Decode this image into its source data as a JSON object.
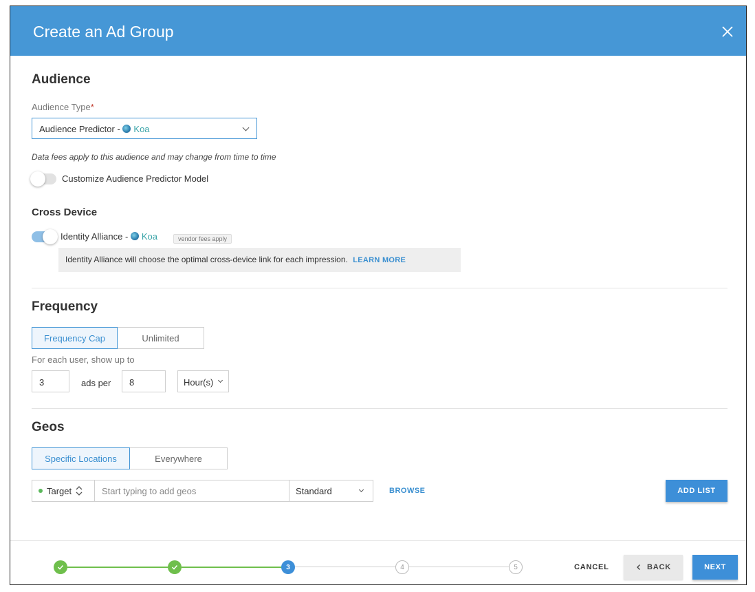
{
  "header": {
    "title": "Create an Ad Group"
  },
  "audience": {
    "section_title": "Audience",
    "type_label": "Audience Type",
    "required_mark": "*",
    "type_value_prefix": "Audience Predictor - ",
    "type_value_vendor": "Koa",
    "data_fees_note": "Data fees apply to this audience and may change from time to time",
    "customize_toggle_label": "Customize Audience Predictor Model",
    "customize_toggle_on": false
  },
  "cross_device": {
    "title": "Cross Device",
    "toggle_on": true,
    "label_prefix": "Identity Alliance - ",
    "vendor": "Koa",
    "badge": "vendor fees apply",
    "info_text": "Identity Alliance will choose the optimal cross-device link for each impression.",
    "learn_more": "LEARN MORE"
  },
  "frequency": {
    "section_title": "Frequency",
    "options": [
      "Frequency Cap",
      "Unlimited"
    ],
    "selected": "Frequency Cap",
    "helper": "For each user, show up to",
    "ads_value": "3",
    "ads_per_label": "ads per",
    "period_value": "8",
    "unit_value": "Hour(s)"
  },
  "geos": {
    "section_title": "Geos",
    "options": [
      "Specific Locations",
      "Everywhere"
    ],
    "selected": "Specific Locations",
    "target_label": "Target",
    "search_placeholder": "Start typing to add geos",
    "type_value": "Standard",
    "browse": "BROWSE",
    "add_list": "ADD LIST"
  },
  "footer": {
    "steps": [
      {
        "label": "",
        "status": "done"
      },
      {
        "label": "",
        "status": "done"
      },
      {
        "label": "3",
        "status": "current"
      },
      {
        "label": "4",
        "status": "todo"
      },
      {
        "label": "5",
        "status": "todo"
      }
    ],
    "cancel": "CANCEL",
    "back": "BACK",
    "next": "NEXT"
  },
  "colors": {
    "header": "#4697d6",
    "primary": "#3d8fd8",
    "success": "#6fbf4c",
    "vendor": "#3aa4a8"
  }
}
